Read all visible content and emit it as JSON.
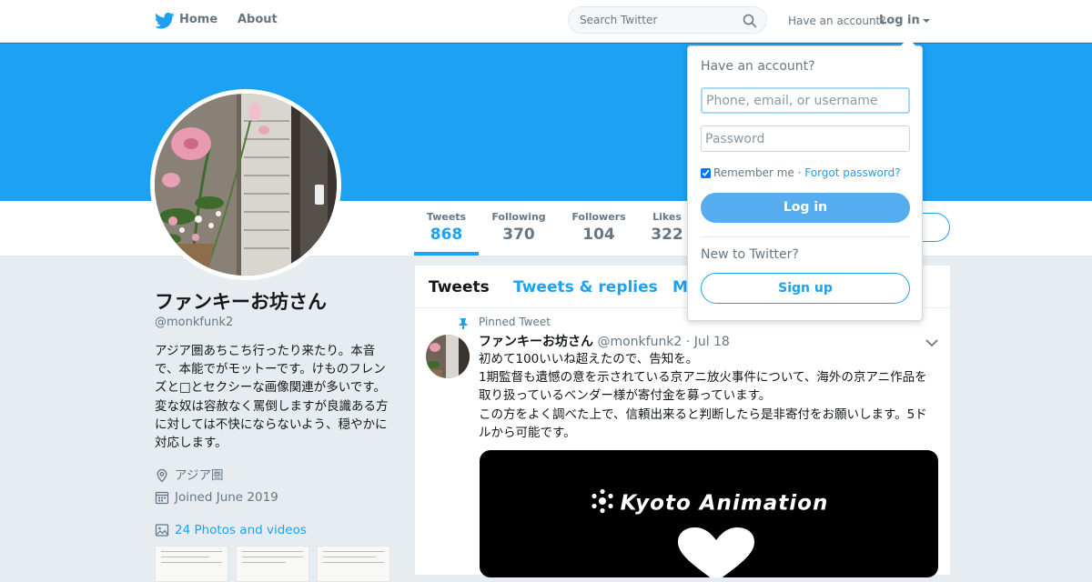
{
  "nav": {
    "home": "Home",
    "about": "About",
    "search_placeholder": "Search Twitter",
    "have_account": "Have an account?",
    "login": "Log in"
  },
  "profile": {
    "name": "ファンキーお坊さん",
    "handle": "@monkfunk2",
    "bio": "アジア圏あちこち行ったり来たり。本音で、本能でがモットーです。けものフレンズと□とセクシーな画像関連が多いです。変な奴は容赦なく罵倒しますが良識ある方に対しては不快にならないよう、穏やかに対応します。",
    "location": "アジア圏",
    "joined": "Joined June 2019",
    "photos": "24 Photos and videos"
  },
  "stats": [
    {
      "label": "Tweets",
      "value": "868"
    },
    {
      "label": "Following",
      "value": "370"
    },
    {
      "label": "Followers",
      "value": "104"
    },
    {
      "label": "Likes",
      "value": "322"
    }
  ],
  "tabs": {
    "tweets": "Tweets",
    "replies": "Tweets & replies",
    "media": "M"
  },
  "tweet": {
    "pinned": "Pinned Tweet",
    "name": "ファンキーお坊さん",
    "handle": "@monkfunk2",
    "dot": "·",
    "date": "Jul 18",
    "lines": [
      "初めて100いいね超えたので、告知を。",
      "1期監督も遺憾の意を示されている京アニ放火事件について、海外の京アニ作品を取り扱っているベンダー様が寄付金を募っています。",
      "この方をよく調べた上で、信頼出来ると判断したら是非寄付をお願いします。5ドルから可能です。"
    ],
    "media_title": "Kyoto Animation"
  },
  "login_dropdown": {
    "title": "Have an account?",
    "user_placeholder": "Phone, email, or username",
    "password_placeholder": "Password",
    "remember": "Remember me",
    "sep": "·",
    "forgot": "Forgot password?",
    "login_button": "Log in",
    "new_to": "New to Twitter?",
    "signup_button": "Sign up"
  },
  "colors": {
    "brand": "#1da1f2",
    "banner": "#1da1f2",
    "background": "#e6ecf0"
  }
}
